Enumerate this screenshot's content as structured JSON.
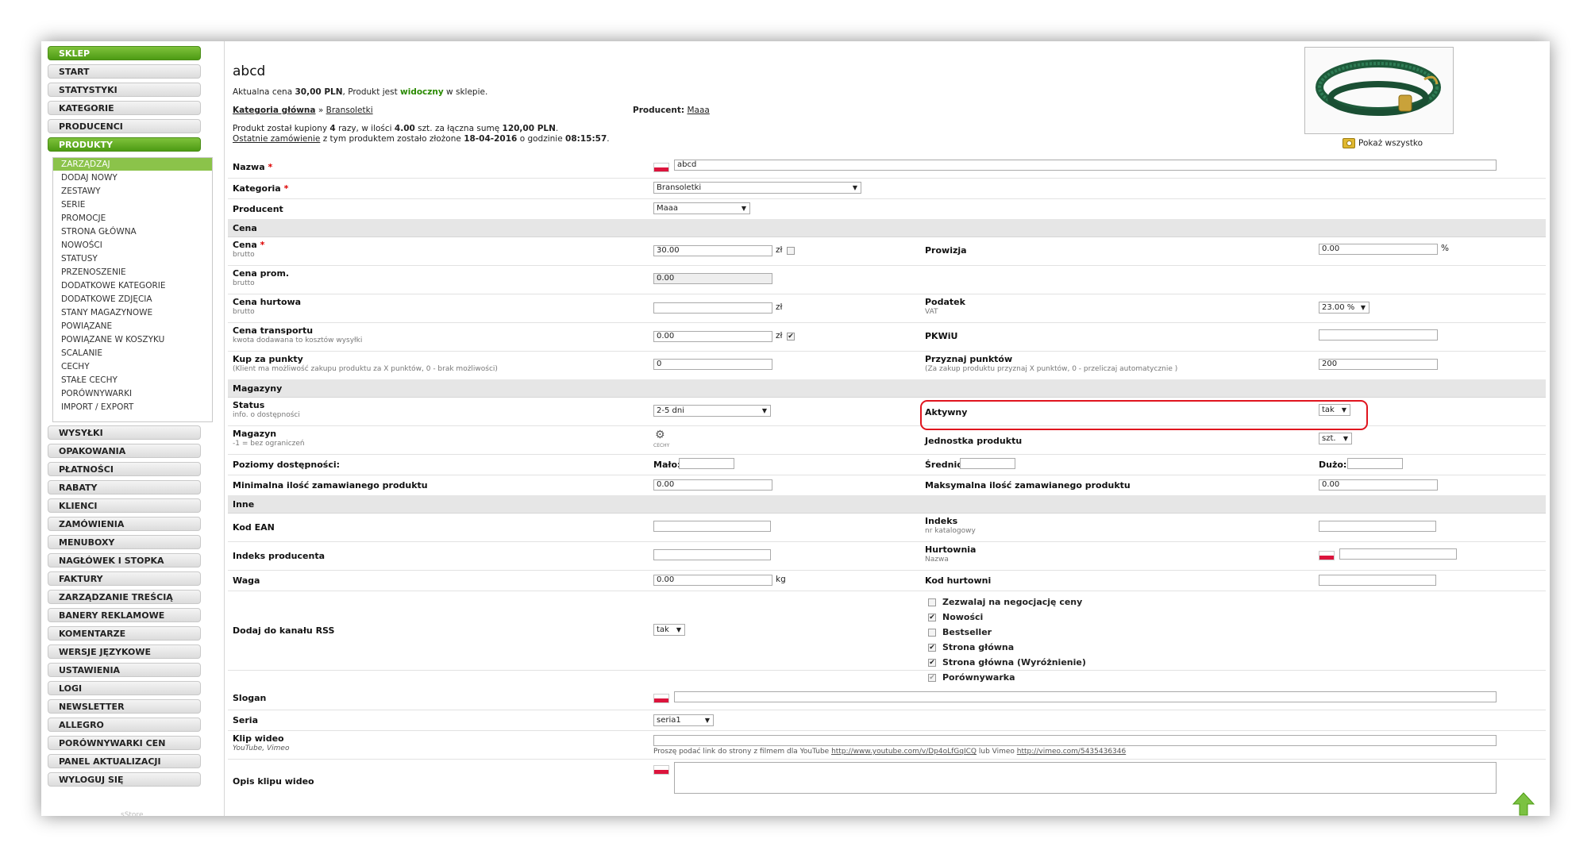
{
  "sidebar": {
    "buttons_top": [
      {
        "label": "SKLEP",
        "active": true
      },
      {
        "label": "START",
        "active": false
      },
      {
        "label": "STATYSTYKI",
        "active": false
      },
      {
        "label": "KATEGORIE",
        "active": false
      },
      {
        "label": "PRODUCENCI",
        "active": false
      },
      {
        "label": "PRODUKTY",
        "active": true
      }
    ],
    "sub_items": [
      "ZARZĄDZAJ",
      "DODAJ NOWY",
      "ZESTAWY",
      "SERIE",
      "PROMOCJE",
      "STRONA GŁÓWNA",
      "NOWOŚCI",
      "STATUSY",
      "PRZENOSZENIE",
      "DODATKOWE KATEGORIE",
      "DODATKOWE ZDJĘCIA",
      "STANY MAGAZYNOWE",
      "POWIĄZANE",
      "POWIĄZANE W KOSZYKU",
      "SCALANIE",
      "CECHY",
      "STAŁE CECHY",
      "PORÓWNYWARKI",
      "IMPORT / EXPORT"
    ],
    "buttons_bottom": [
      "WYSYŁKI",
      "OPAKOWANIA",
      "PŁATNOŚCI",
      "RABATY",
      "KLIENCI",
      "ZAMÓWIENIA",
      "MENUBOXY",
      "NAGŁÓWEK I STOPKA",
      "FAKTURY",
      "ZARZĄDZANIE TREŚCIĄ",
      "BANERY REKLAMOWE",
      "KOMENTARZE",
      "WERSJE JĘZYKOWE",
      "USTAWIENIA",
      "LOGI",
      "NEWSLETTER",
      "ALLEGRO",
      "PORÓWNYWARKI CEN",
      "PANEL AKTUALIZACJI",
      "WYLOGUJ SIĘ"
    ],
    "footer": "sStore"
  },
  "header": {
    "title": "abcd",
    "price_prefix": "Aktualna cena ",
    "price": "30,00 PLN",
    "visible_prefix": ", Produkt jest ",
    "visible": "widoczny",
    "visible_suffix": " w sklepie.",
    "main_category_label": "Kategoria główna",
    "category_sep": " » ",
    "category": "Bransoletki",
    "producer_label": "Producent:",
    "producer": "Maaa",
    "bought_text_1": "Produkt został kupiony ",
    "bought_times": "4",
    "bought_text_2": " razy, w ilości ",
    "bought_qty": "4.00",
    "bought_text_3": " szt. za łączna sumę ",
    "bought_sum": "120,00 PLN",
    "bought_text_4": ".",
    "last_order_link": "Ostatnie zamówienie",
    "last_order_text": " z tym produktem zostało złożone ",
    "last_order_date": "18-04-2016",
    "last_order_time_prefix": " o godzinie ",
    "last_order_time": "08:15:57",
    "last_order_end": ".",
    "show_all": "Pokaż wszystko"
  },
  "form": {
    "name_label": "Nazwa",
    "name_value": "abcd",
    "category_label": "Kategoria",
    "category_value": "Bransoletki",
    "producer_label": "Producent",
    "producer_value": "Maaa",
    "sect_price": "Cena",
    "price_label": "Cena",
    "price_sub": "brutto",
    "price_value": "30.00",
    "currency": "zł",
    "commission_label": "Prowizja",
    "commission_value": "0.00",
    "percent": "%",
    "promo_label": "Cena prom.",
    "promo_sub": "brutto",
    "promo_value": "0.00",
    "wholesale_label": "Cena hurtowa",
    "wholesale_sub": "brutto",
    "wholesale_value": "",
    "tax_label": "Podatek",
    "tax_sub": "VAT",
    "tax_value": "23.00 %",
    "transport_label": "Cena transportu",
    "transport_sub": "kwota dodawana to kosztów wysyłki",
    "transport_value": "0.00",
    "pkwiu_label": "PKWiU",
    "pkwiu_value": "",
    "buy_points_label": "Kup za punkty",
    "buy_points_sub": "(Klient ma możliwość zakupu produktu za X punktów, 0 - brak możliwości)",
    "buy_points_value": "0",
    "grant_points_label": "Przyznaj punktów",
    "grant_points_sub": "(Za zakup produktu przyznaj X punktów, 0 - przeliczaj automatycznie )",
    "grant_points_value": "200",
    "sect_stock": "Magazyny",
    "status_label": "Status",
    "status_sub": "info. o dostępności",
    "status_value": "2-5 dni",
    "active_label": "Aktywny",
    "active_value": "tak",
    "warehouse_label": "Magazyn",
    "warehouse_sub": "-1 = bez ograniczeń",
    "features_caption": "CECHY",
    "unit_label": "Jednostka produktu",
    "unit_value": "szt.",
    "levels_label": "Poziomy dostępności:",
    "low_label": "Mało:",
    "mid_label": "Średnio:",
    "high_label": "Dużo:",
    "min_label": "Minimalna ilość zamawianego produktu",
    "min_value": "0.00",
    "max_label": "Maksymalna ilość zamawianego produktu",
    "max_value": "0.00",
    "sect_other": "Inne",
    "ean_label": "Kod EAN",
    "index_label": "Indeks",
    "index_sub": "nr katalogowy",
    "producer_index_label": "Indeks producenta",
    "wholesaler_label": "Hurtownia",
    "wholesaler_sub": "Nazwa",
    "weight_label": "Waga",
    "weight_value": "0.00",
    "weight_unit": "kg",
    "wholesaler_code_label": "Kod hurtowni",
    "rss_label": "Dodaj do kanału RSS",
    "rss_value": "tak",
    "checkboxes": [
      {
        "label": "Zezwalaj na negocjację ceny",
        "checked": false
      },
      {
        "label": "Nowości",
        "checked": true
      },
      {
        "label": "Bestseller",
        "checked": false
      },
      {
        "label": "Strona główna",
        "checked": true
      },
      {
        "label": "Strona główna (Wyróżnienie)",
        "checked": true
      },
      {
        "label": "Porównywarka",
        "checked": true
      }
    ],
    "slogan_label": "Slogan",
    "series_label": "Seria",
    "series_value": "seria1",
    "video_label": "Klip wideo",
    "video_sub": "YouTube, Vimeo",
    "video_note_1": "Proszę podać link do strony z filmem dla YouTube ",
    "video_link_yt": "http://www.youtube.com/v/Dp4oLfGqICQ",
    "video_note_2": " lub Vimeo ",
    "video_link_vimeo": "http://vimeo.com/5435436346",
    "video_desc_label": "Opis klipu wideo"
  }
}
